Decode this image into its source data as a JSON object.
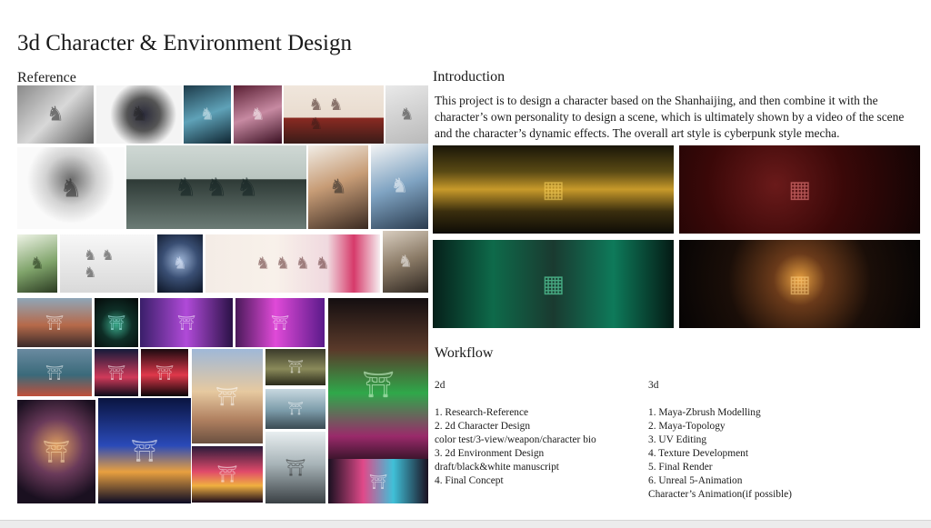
{
  "page": {
    "title": "3d Character & Environment Design"
  },
  "reference": {
    "label": "Reference"
  },
  "introduction": {
    "label": "Introduction",
    "text": "This project is to design a character based on the Shanhaijing, and then combine it with the character’s own personality to design a scene, which is ultimately shown by a video of the scene and the character’s dynamic effects. The overall art style is cyberpunk style mecha."
  },
  "workflow": {
    "label": "Workflow",
    "col2d": {
      "heading": "2d",
      "items": [
        "1. Research-Reference",
        "2. 2d Character Design",
        "color test/3-view/weapon/character bio",
        "3. 2d Environment Design",
        "draft/black&white manuscript",
        "4. Final Concept"
      ]
    },
    "col3d": {
      "heading": "3d",
      "items": [
        "1. Maya-Zbrush Modelling",
        "2. Maya-Topology",
        "3. UV Editing",
        "4. Texture Development",
        "5. Final Render",
        "6. Unreal 5-Animation",
        "Character’s Animation(if possible)"
      ]
    }
  },
  "icons": {
    "reference_image": "character-artwork-icon",
    "environment_image": "environment-artwork-icon",
    "render_image": "cyberpunk-render-icon"
  }
}
